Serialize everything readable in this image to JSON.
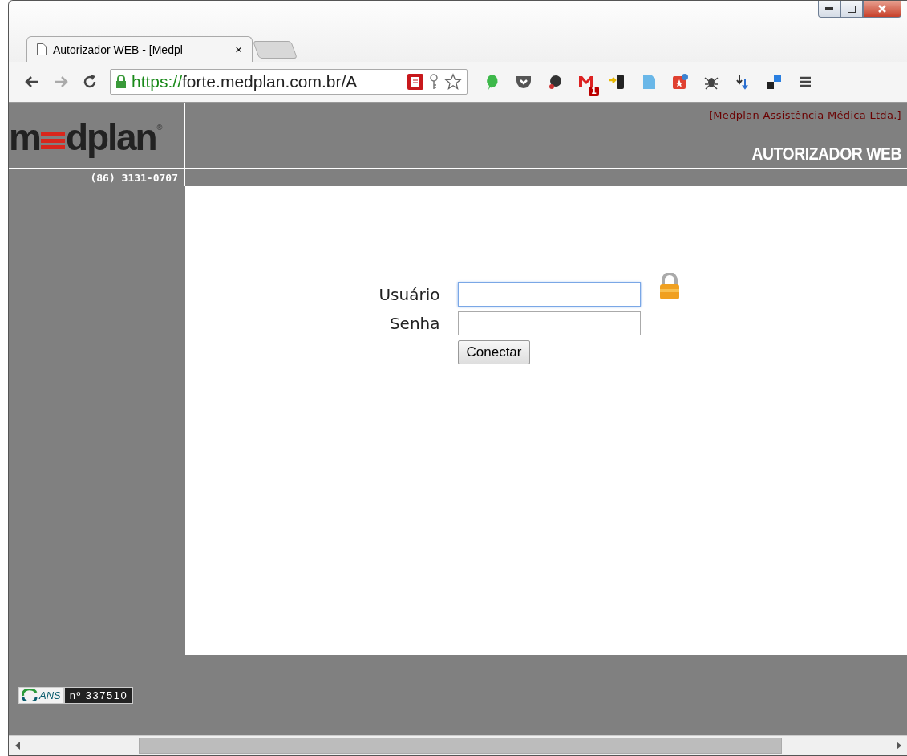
{
  "browser": {
    "tab": {
      "title": "Autorizador WEB - [Medpl",
      "close": "×",
      "selected": true
    },
    "url": {
      "scheme": "https://",
      "rest": "forte.medplan.com.br/A"
    },
    "mail_badge": "1"
  },
  "header": {
    "logo_start": "m",
    "logo_end": "dplan",
    "logo_mark": "®",
    "company": "[Medplan Assistência Médica Ltda.]",
    "title": "AUTORIZADOR WEB",
    "phone": "(86) 3131-0707"
  },
  "login": {
    "fields": [
      {
        "label": "Usuário",
        "focused": true
      },
      {
        "label": "Senha",
        "focused": false
      }
    ],
    "button": "Conectar"
  },
  "footer": {
    "ans": "ANS",
    "registry": "nº 337510"
  }
}
